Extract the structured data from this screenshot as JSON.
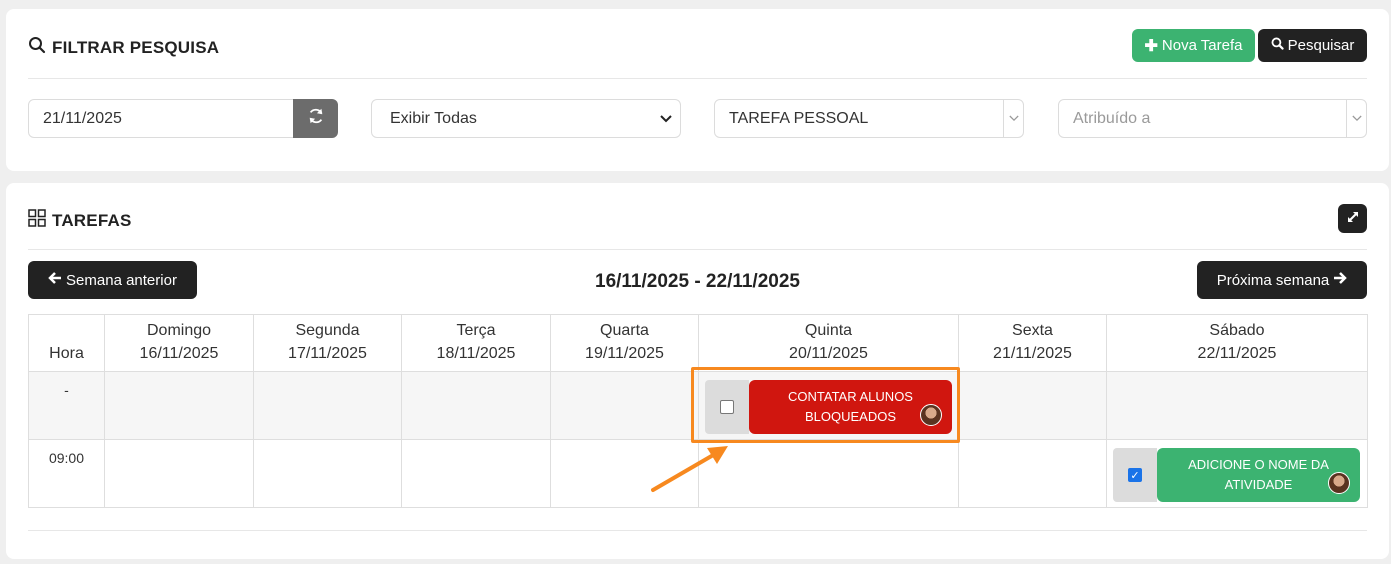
{
  "filter": {
    "title": "FILTRAR PESQUISA",
    "new_task_label": "Nova Tarefa",
    "search_label": "Pesquisar",
    "date_value": "21/11/2025",
    "show_select": "Exibir Todas",
    "type_select": "TAREFA PESSOAL",
    "assigned_placeholder": "Atribuído a"
  },
  "tasks": {
    "title": "TAREFAS",
    "prev_week_label": "Semana anterior",
    "next_week_label": "Próxima semana",
    "week_range": "16/11/2025 - 22/11/2025",
    "hour_header": "Hora",
    "days": [
      {
        "name": "Domingo",
        "date": "16/11/2025"
      },
      {
        "name": "Segunda",
        "date": "17/11/2025"
      },
      {
        "name": "Terça",
        "date": "18/11/2025"
      },
      {
        "name": "Quarta",
        "date": "19/11/2025"
      },
      {
        "name": "Quinta",
        "date": "20/11/2025"
      },
      {
        "name": "Sexta",
        "date": "21/11/2025"
      },
      {
        "name": "Sábado",
        "date": "22/11/2025"
      }
    ],
    "rows": [
      {
        "hour": "-"
      },
      {
        "hour": "09:00"
      }
    ],
    "items": [
      {
        "label": "CONTATAR ALUNOS BLOQUEADOS",
        "day": "Quinta",
        "hour": "-",
        "checked": false,
        "color": "#d0160f"
      },
      {
        "label": "ADICIONE O NOME DA ATIVIDADE",
        "day": "Sábado",
        "hour": "09:00",
        "checked": true,
        "color": "#3cb371"
      }
    ]
  },
  "colors": {
    "accent_green": "#3cb371",
    "dark_button": "#222222",
    "task_red": "#d0160f",
    "highlight_orange": "#f7891f"
  }
}
